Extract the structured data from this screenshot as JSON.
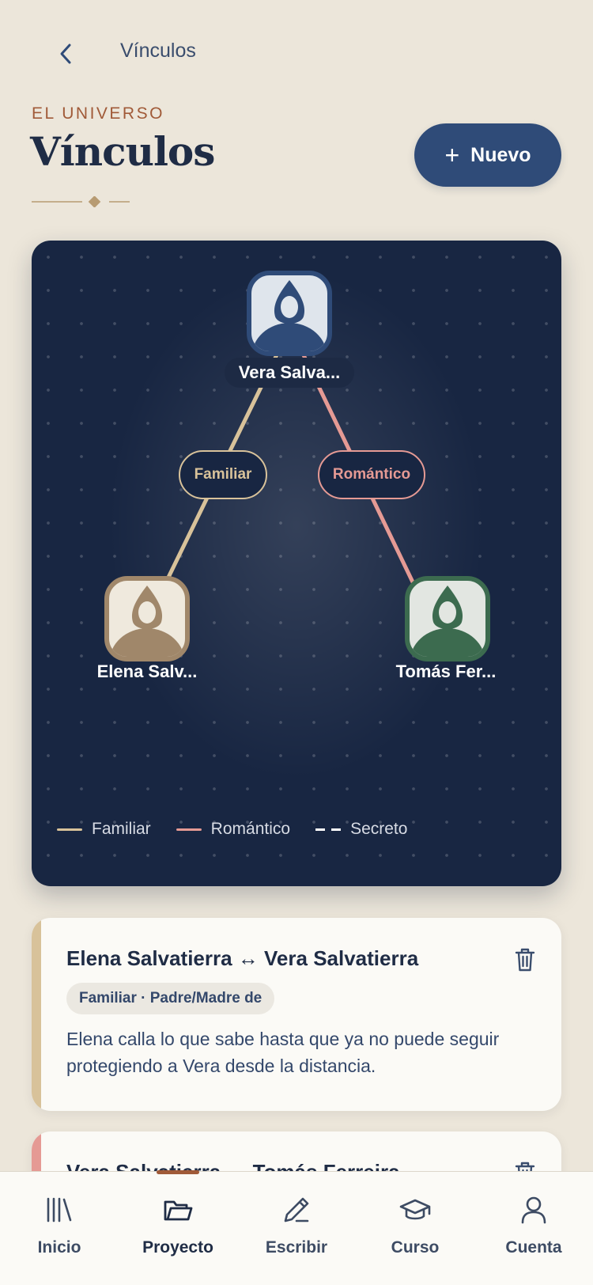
{
  "topbar": {
    "title": "Vínculos"
  },
  "header": {
    "eyebrow": "EL UNIVERSO",
    "title": "Vínculos",
    "new_button": "Nuevo"
  },
  "graph": {
    "nodes": [
      {
        "name": "Vera Salva...",
        "color": "#2f4b78"
      },
      {
        "name": "Elena Salv...",
        "color": "#a0876a"
      },
      {
        "name": "Tomás Fer...",
        "color": "#3c6b4f"
      }
    ],
    "edges": [
      {
        "label": "Familiar",
        "color": "#d8c29a"
      },
      {
        "label": "Romántico",
        "color": "#e59a94"
      }
    ],
    "legend": [
      {
        "label": "Familiar",
        "color": "#d8c29a"
      },
      {
        "label": "Romántico",
        "color": "#e59a94"
      },
      {
        "label": "Secreto",
        "color": "#ffffff"
      }
    ]
  },
  "relations": [
    {
      "title": "Elena Salvatierra ↔ Vera Salvatierra",
      "tag": "Familiar · Padre/Madre de",
      "description": "Elena calla lo que sabe hasta que ya no puede seguir protegiendo a Vera desde la distancia.",
      "accent": "#d8c29a"
    },
    {
      "title": "Vera Salvatierra ↔ Tomás Ferreira",
      "accent": "#e59a94"
    }
  ],
  "tabbar": {
    "tabs": [
      {
        "label": "Inicio",
        "icon": "library-icon"
      },
      {
        "label": "Proyecto",
        "icon": "folder-icon"
      },
      {
        "label": "Escribir",
        "icon": "pen-icon"
      },
      {
        "label": "Curso",
        "icon": "graduation-cap-icon"
      },
      {
        "label": "Cuenta",
        "icon": "user-icon"
      }
    ],
    "active": "Proyecto"
  }
}
